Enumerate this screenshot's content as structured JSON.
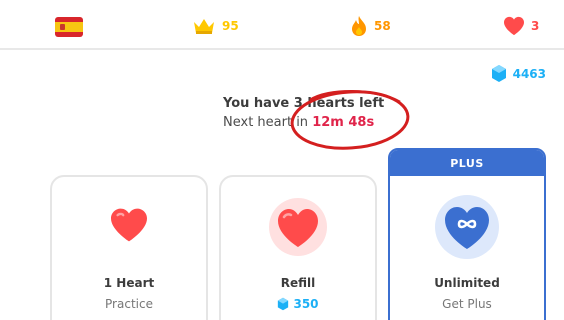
{
  "topbar": {
    "language_flag": "spain-flag",
    "crowns": "95",
    "streak": "58",
    "hearts": "3"
  },
  "gems": {
    "balance": "4463"
  },
  "hearts_info": {
    "title": "You have 3 hearts left",
    "next_prefix": "Next heart in ",
    "timer": "12m 48s"
  },
  "cards": [
    {
      "title": "1 Heart",
      "subtitle": "Practice"
    },
    {
      "title": "Refill",
      "price": "350"
    },
    {
      "badge": "PLUS",
      "title": "Unlimited",
      "subtitle": "Get Plus"
    }
  ],
  "colors": {
    "crown": "#ffc800",
    "streak": "#ff9600",
    "heart": "#ff4b4b",
    "gem": "#1cb0f6",
    "plus_blue": "#3b6fd0",
    "annotation": "#d41f1f"
  }
}
